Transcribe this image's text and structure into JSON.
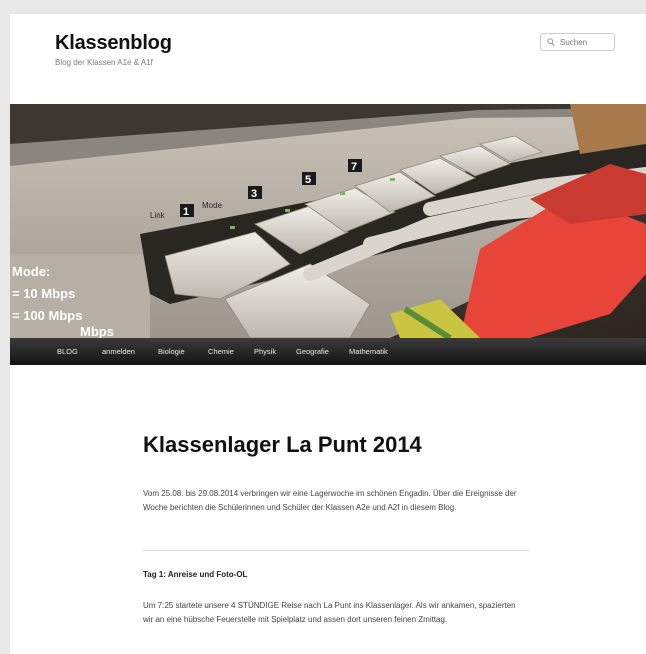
{
  "header": {
    "site_title": "Klassenblog",
    "site_description": "Blog der Klassen A1e & A1f",
    "search_placeholder": "Suchen"
  },
  "hero_image": {
    "port_labels": [
      "1",
      "3",
      "5",
      "7"
    ],
    "text_link": "Link",
    "text_mode": "Mode",
    "side_lines": [
      "Mode:",
      "= 10 Mbps",
      "= 100 Mbps",
      "Mbps"
    ]
  },
  "nav": {
    "items": [
      "BLOG",
      "anmelden",
      "Biologie",
      "Chemie",
      "Physik",
      "Geografie",
      "Mathematik"
    ]
  },
  "post": {
    "title": "Klassenlager La Punt 2014",
    "intro": "Vom 25.08. bis 29.08.2014 verbringen wir eine Lagerwoche im schönen Engadin. Über die Ereignisse der Woche berichten die Schülerinnen und Schüler der Klassen A2e und A2f in diesem Blog.",
    "day1_heading": "Tag 1: Anreise und Foto-OL",
    "day1_text": "Um 7:25 startete unsere 4 STÜNDIGE Reise nach La Punt ins Klassenlager. Als wir ankamen, spazierten wir an eine hübsche Feuerstelle mit Spielplatz und assen dort unseren feinen Zmittag."
  },
  "colors": {
    "nav_bg": "#1f1f1f",
    "cable_red": "#e8453a",
    "cable_yellow_green": "#c9c441"
  }
}
